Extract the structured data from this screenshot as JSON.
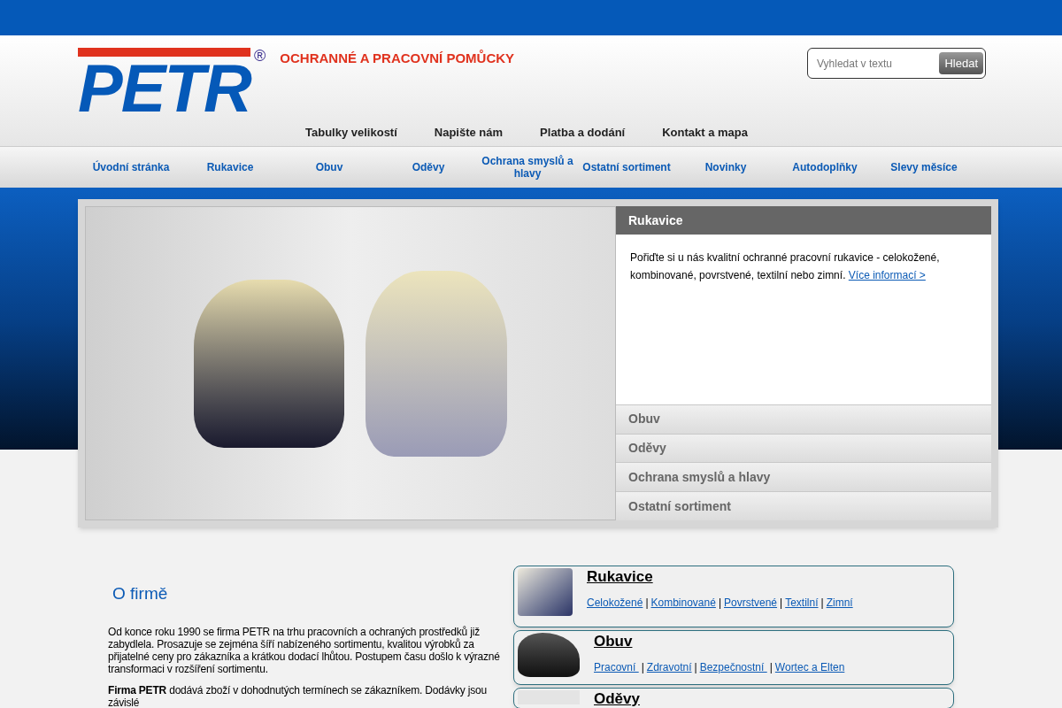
{
  "header": {
    "logo": "PETR",
    "registered": "®",
    "tagline": "OCHRANNÉ A PRACOVNÍ POMŮCKY",
    "search": {
      "placeholder": "Vyhledat v textu",
      "button": "Hledat"
    }
  },
  "top_links": [
    "Tabulky velikostí",
    "Napište nám",
    "Platba a dodání",
    "Kontakt a mapa"
  ],
  "main_nav": [
    {
      "label": "Úvodní stránka"
    },
    {
      "label": "Rukavice"
    },
    {
      "label": "Obuv"
    },
    {
      "label": "Oděvy"
    },
    {
      "label": "Ochrana smyslů a hlavy"
    },
    {
      "label": "Ostatní sortiment"
    },
    {
      "label": "Novinky"
    },
    {
      "label": "Autodoplňky"
    },
    {
      "label": "Slevy měsíce"
    }
  ],
  "slider": {
    "items": [
      {
        "label": "Rukavice",
        "expanded": true,
        "text": "Pořiďte si u nás kvalitní ochranné pracovní rukavice - celokožené, kombinované, povrstvené, textilní nebo zimní.",
        "link": "Více informací >"
      },
      {
        "label": "Obuv",
        "expanded": false
      },
      {
        "label": "Oděvy",
        "expanded": false
      },
      {
        "label": "Ochrana smyslů a hlavy",
        "expanded": false
      },
      {
        "label": "Ostatní sortiment",
        "expanded": false
      }
    ]
  },
  "about": {
    "title": "O firmě",
    "paragraphs": [
      "Od konce roku 1990 se firma PETR na trhu pracovních a ochraných prostředků již zabydlela. Prosazuje se zejména šíří nabízeného sortimentu, kvalitou výrobků za přijatelné ceny pro zákazníka a krátkou dodací lhůtou. Postupem času došlo k výrazné transformaci v rozšíření sortimentu.",
      "**Firma PETR** dodává zboží v dohodnutých termínech se zákazníkem. Dodávky jsou závislé"
    ]
  },
  "categories": [
    {
      "title": "Rukavice",
      "kind": "gloves",
      "separator": "|",
      "links": [
        "Celokožené",
        "Kombinované",
        "Povrstvené",
        "Textilní",
        "Zimní"
      ]
    },
    {
      "title": "Obuv",
      "kind": "shoe",
      "separator": "|",
      "links": [
        "Pracovní ",
        "Zdravotní",
        "Bezpečnostní ",
        "Wortec a Elten"
      ]
    },
    {
      "title": "Oděvy",
      "kind": "clothing"
    }
  ]
}
